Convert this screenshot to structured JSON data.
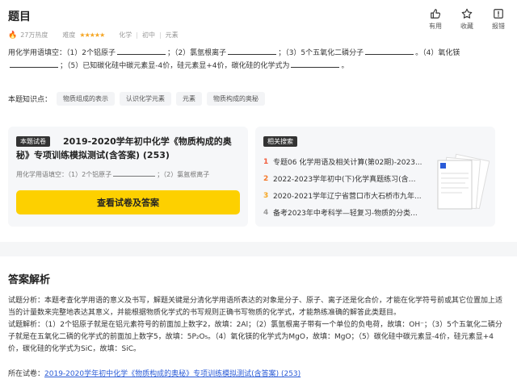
{
  "header": {
    "title": "题目",
    "hot": "27万热度",
    "difficulty_label": "难度",
    "stars": "★★★★★",
    "subject": "化学",
    "grade": "初中",
    "chapter": "元素"
  },
  "actions": {
    "like": "有用",
    "fav": "收藏",
    "report": "报错"
  },
  "question": {
    "p1": "用化学用语填空：（1）2个铝原子",
    "p2": "；（2）氯氩根离子",
    "p3": "；（3）5个五氧化二磷分子",
    "p4": "。（4）氧化镁",
    "p5": "；（5）已知碳化硅中碳元素显-4价，硅元素显+4价，碳化硅的化学式为",
    "p6": "。"
  },
  "knowledge": {
    "label": "本题知识点：",
    "tags": [
      "物质组成的表示",
      "认识化学元素",
      "元素",
      "物质构成的奥秘"
    ]
  },
  "paper": {
    "badge": "本题试卷",
    "title": "2019-2020学年初中化学《物质构成的奥秘》专项训练模拟测试(含答案) (253)",
    "snippet_a": "用化学用语填空：（1）2个铝原子",
    "snippet_b": "；（2）氯氩根离子",
    "button": "查看试卷及答案"
  },
  "related": {
    "badge": "相关搜索",
    "items": [
      {
        "num": "1",
        "text": "专题06 化学用语及相关计算(第02期)-2023..."
      },
      {
        "num": "2",
        "text": "2022-2023学年初中(下)化学真题练习(含答..."
      },
      {
        "num": "3",
        "text": "2020-2021学年辽宁省营口市大石桥市九年..."
      },
      {
        "num": "4",
        "text": "备考2023年中考科学—轻复习-物质的分类..."
      }
    ]
  },
  "answer": {
    "title": "答案解析",
    "analysis": "试题分析：本题考查化学用语的意义及书写，解题关键是分清化学用语所表达的对象是分子、原子、离子还是化合价，才能在化学符号前或其它位置加上适当的计量数来完整地表达其意义，并能根据物质化学式的书写规则正确书写物质的化学式，才能熟练准确的解答此类题目。",
    "solution": "试题解析：（1）2个铝原子就是在铝元素符号的前面加上数字2，故填：2Al；（2）氯氩根离子带有一个单位的负电荷，故填：OH⁻；（3）5个五氧化二磷分子就是在五氧化二磷的化学式的前面加上数字5，故填：5P₂O₅。（4）氧化镁的化学式为MgO，故填：MgO；（5）碳化硅中碳元素显-4价，硅元素显+4价，碳化硅的化学式为SiC，故填：SiC。",
    "source_label": "所在试卷：",
    "source_link": "2019-2020学年初中化学《物质构成的奥秘》专项训练模拟测试(含答案) (253)"
  },
  "colors": {
    "button_yellow": "#fdd000",
    "link_blue": "#2a5bd7",
    "star_orange": "#f5a623",
    "hot_red": "#f25c3c"
  }
}
